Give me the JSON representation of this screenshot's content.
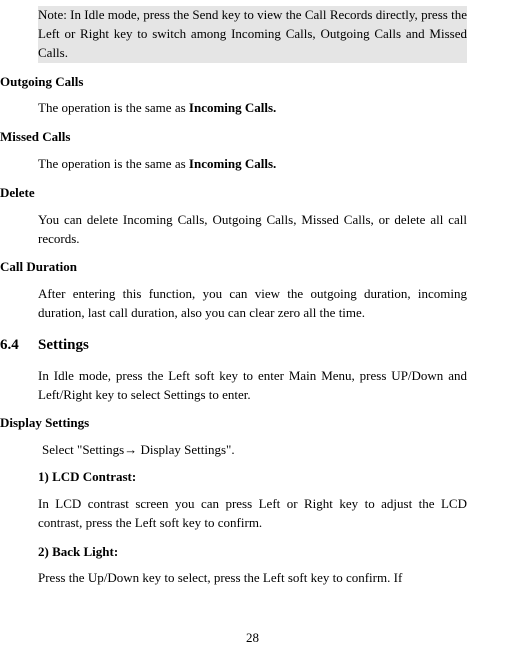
{
  "note": "Note: In Idle mode, press the Send key to view the Call Records directly, press the Left or Right key to switch among Incoming Calls, Outgoing Calls and Missed Calls.",
  "sections": {
    "outgoing": {
      "title": "Outgoing Calls",
      "text_prefix": "The operation is the same as ",
      "text_bold": "Incoming Calls."
    },
    "missed": {
      "title": "Missed Calls",
      "text_prefix": "The operation is the same as ",
      "text_bold": "Incoming Calls."
    },
    "delete": {
      "title": "Delete",
      "text": "You can delete Incoming Calls, Outgoing Calls, Missed Calls, or delete all call records."
    },
    "duration": {
      "title": "Call Duration",
      "text": "After entering this function, you can view the outgoing duration, incoming duration, last call duration, also you can clear zero all the time."
    }
  },
  "settings": {
    "num": "6.4",
    "title": "Settings",
    "intro": "In Idle mode, press the Left soft key to enter Main Menu, press UP/Down and Left/Right key to select Settings to enter."
  },
  "display": {
    "title": "Display Settings",
    "select_text": " Select \"Settings→ Display Settings\".",
    "item1": {
      "label": "1) LCD Contrast:",
      "text": "In LCD contrast screen you can press Left or Right key to adjust the LCD contrast, press the Left soft key to confirm."
    },
    "item2": {
      "label": "2) Back Light:",
      "text": "Press the Up/Down key to select, press the Left soft key to confirm. If"
    }
  },
  "page_number": "28"
}
